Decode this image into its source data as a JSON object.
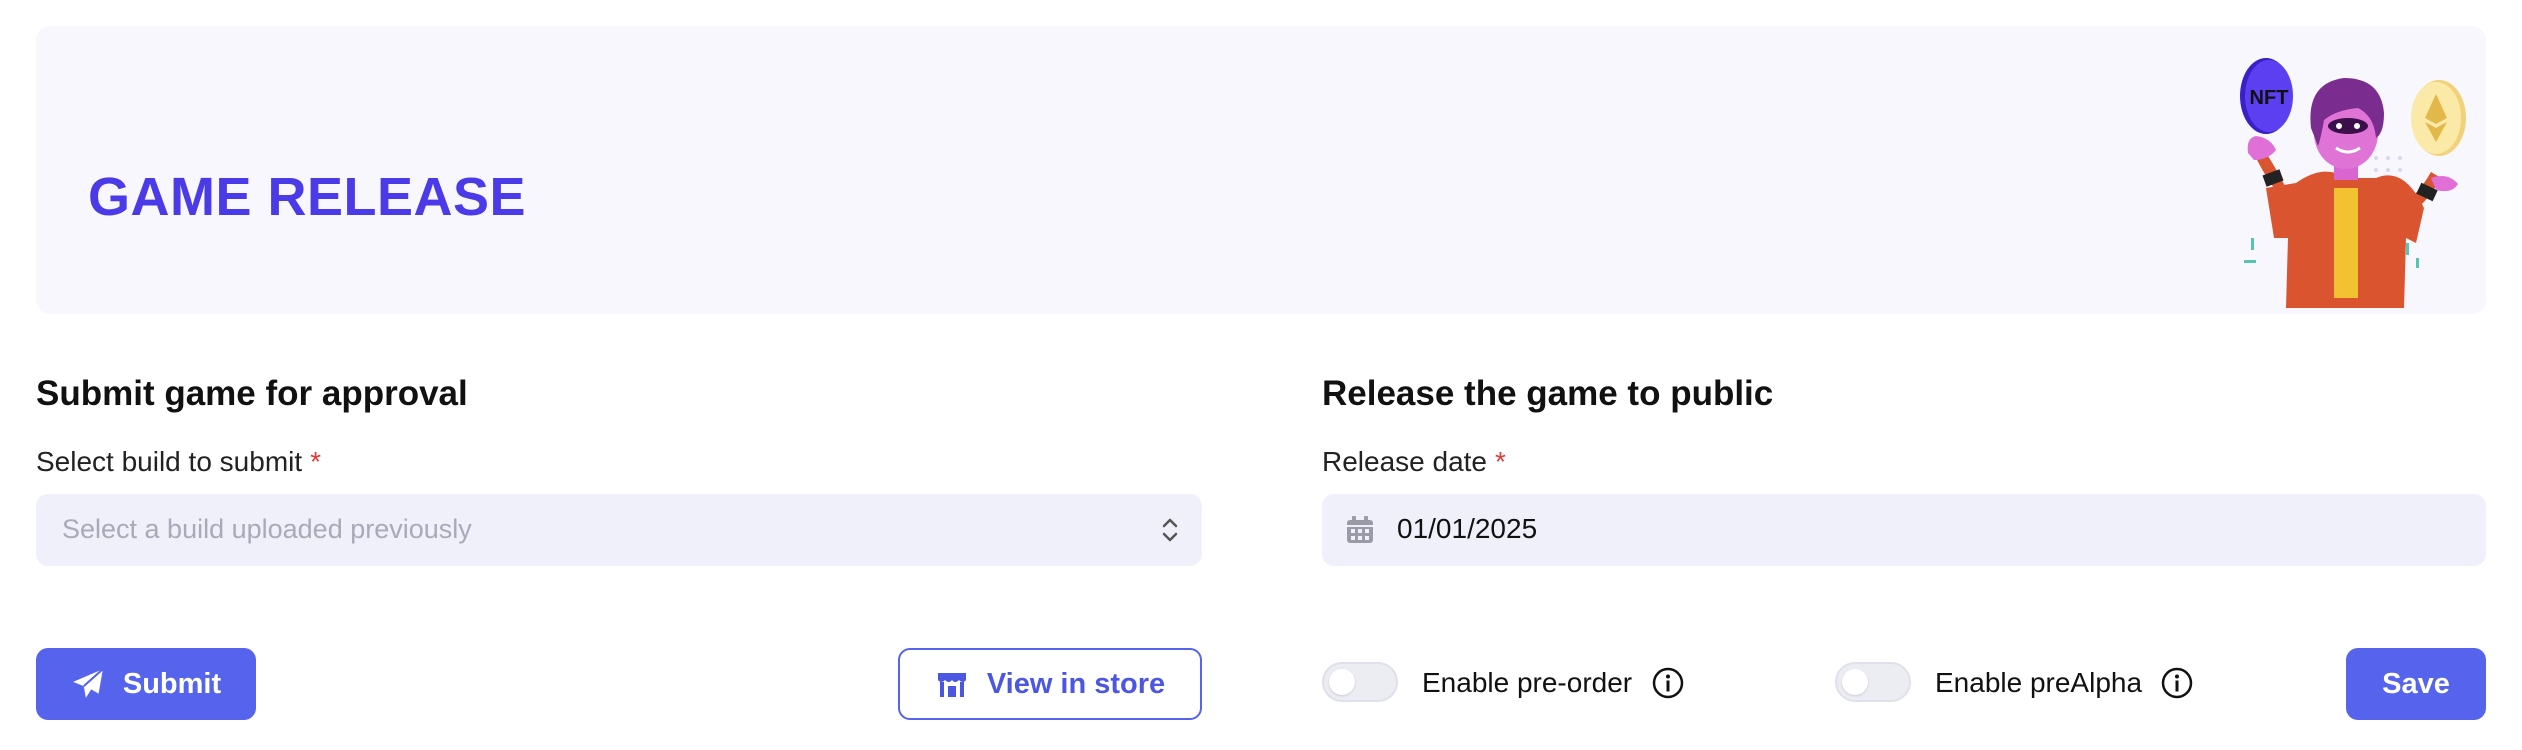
{
  "banner": {
    "title": "GAME RELEASE",
    "illustration_coin_text": "NFT"
  },
  "submit_section": {
    "title": "Submit game for approval",
    "build_label": "Select build to submit",
    "required_mark": "*",
    "build_placeholder": "Select a build uploaded previously",
    "submit_button": "Submit",
    "view_store_button": "View in store"
  },
  "release_section": {
    "title": "Release the game to public",
    "date_label": "Release date",
    "required_mark": "*",
    "date_value": "01/01/2025",
    "preorder_label": "Enable pre-order",
    "preorder_enabled": false,
    "prealpha_label": "Enable preAlpha",
    "prealpha_enabled": false,
    "save_button": "Save"
  },
  "colors": {
    "accent": "#5663ec",
    "title": "#4a3ae8",
    "banner_bg": "#f8f7fd",
    "input_bg": "#f0f0fb",
    "required": "#e53935"
  },
  "icons": {
    "submit": "paper-plane-icon",
    "store": "storefront-icon",
    "calendar": "calendar-icon",
    "chevron": "chevron-up-down-icon",
    "info": "info-icon"
  }
}
